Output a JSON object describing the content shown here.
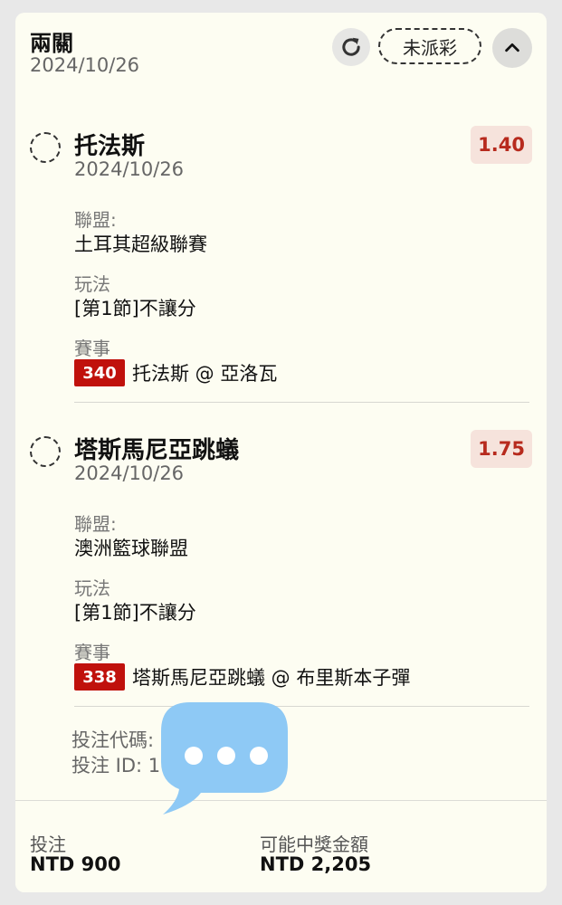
{
  "header": {
    "title": "兩關",
    "date": "2024/10/26",
    "status": "未派彩",
    "icons": {
      "refresh": "refresh-icon",
      "collapse": "chevron-up-icon"
    }
  },
  "legs": [
    {
      "team": "托法斯",
      "date": "2024/10/26",
      "odds": "1.40",
      "league_label": "聯盟:",
      "league": "土耳其超級聯賽",
      "play_label": "玩法",
      "play": "[第1節]不讓分",
      "event_label": "賽事",
      "event_no": "340",
      "event": "托法斯 @ 亞洛瓦"
    },
    {
      "team": "塔斯馬尼亞跳蟻",
      "date": "2024/10/26",
      "odds": "1.75",
      "league_label": "聯盟:",
      "league": "澳洲籃球聯盟",
      "play_label": "玩法",
      "play": "[第1節]不讓分",
      "event_label": "賽事",
      "event_no": "338",
      "event": "塔斯馬尼亞跳蟻 @ 布里斯本子彈"
    }
  ],
  "bet": {
    "code_label": "投注代碼:",
    "id_label": "投注 ID: 1"
  },
  "footer": {
    "stake_label": "投注",
    "stake": "NTD 900",
    "payout_label": "可能中獎金額",
    "payout": "NTD 2,205"
  },
  "colors": {
    "card_bg": "#fdfdf2",
    "odds_text": "#b72a1d",
    "odds_bg": "#f6e3dc",
    "event_badge": "#c0110c",
    "chat_bubble": "#8ec9f5"
  },
  "overlay": {
    "icon": "chat-bubble-icon"
  }
}
